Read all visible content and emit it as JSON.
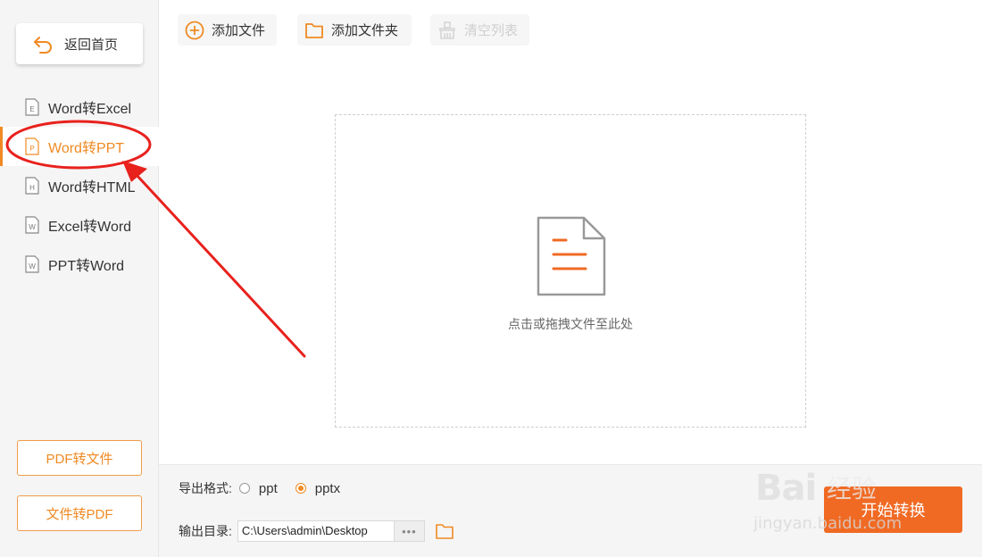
{
  "sidebar": {
    "back_label": "返回首页",
    "items": [
      {
        "label": "Word转Excel",
        "letter": "E",
        "active": false
      },
      {
        "label": "Word转PPT",
        "letter": "P",
        "active": true
      },
      {
        "label": "Word转HTML",
        "letter": "H",
        "active": false
      },
      {
        "label": "Excel转Word",
        "letter": "W",
        "active": false
      },
      {
        "label": "PPT转Word",
        "letter": "W",
        "active": false
      }
    ],
    "pdf_to_file_label": "PDF转文件",
    "file_to_pdf_label": "文件转PDF"
  },
  "toolbar": {
    "add_file_label": "添加文件",
    "add_folder_label": "添加文件夹",
    "clear_list_label": "清空列表"
  },
  "dropzone": {
    "hint": "点击或拖拽文件至此处"
  },
  "bottom": {
    "format_label": "导出格式:",
    "format_options": [
      "ppt",
      "pptx"
    ],
    "format_selected": "pptx",
    "output_label": "输出目录:",
    "output_path": "C:\\Users\\admin\\Desktop",
    "more_label": "•••",
    "start_label": "开始转换"
  },
  "watermark": {
    "brand": "Bai",
    "sub": "经验",
    "url": "jingyan.baidu.com"
  },
  "colors": {
    "accent": "#f08a24",
    "start": "#f06a24",
    "annotation": "#e8211d"
  },
  "icons": {
    "back": "undo-arrow-icon",
    "add_file": "plus-circle-icon",
    "add_folder": "folder-icon",
    "clear_list": "broom-icon",
    "document": "document-icon",
    "output_folder": "folder-icon"
  }
}
